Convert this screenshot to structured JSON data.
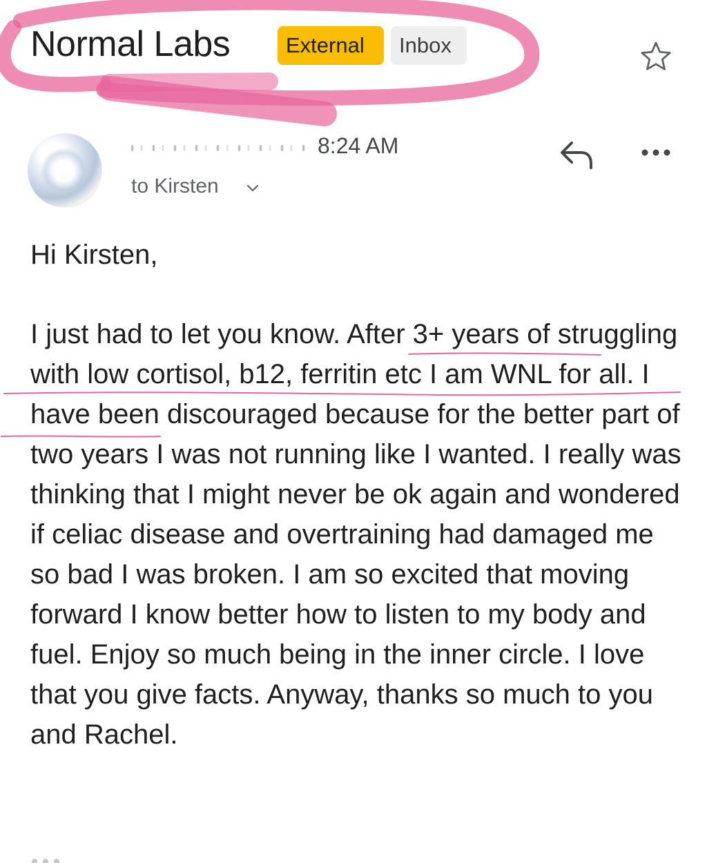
{
  "email": {
    "subject": "Normal Labs",
    "labels": {
      "external": "External",
      "inbox": "Inbox"
    },
    "time": "8:24 AM",
    "recipient": "to Kirsten",
    "greeting": "Hi Kirsten,",
    "message": "I just had to let you know. After 3+ years of struggling with low cortisol, b12, ferritin etc I am WNL for all. I have been discouraged because for the better part of two years I was not running like I wanted. I really was thinking that I might never be ok again and wondered if celiac disease and overtraining had damaged me so bad I was broken. I am so excited that moving forward I know better how to listen to my body and fuel. Enjoy so much being in the inner circle. I love that you give facts. Anyway, thanks so much to you and Rachel."
  },
  "icons": [
    "star-icon",
    "reply-icon",
    "more-options-icon",
    "chevron-down-icon"
  ],
  "colors": {
    "external_label": "#fbbc04",
    "inbox_label": "#eeeeee",
    "annotation": "#e8659b"
  }
}
